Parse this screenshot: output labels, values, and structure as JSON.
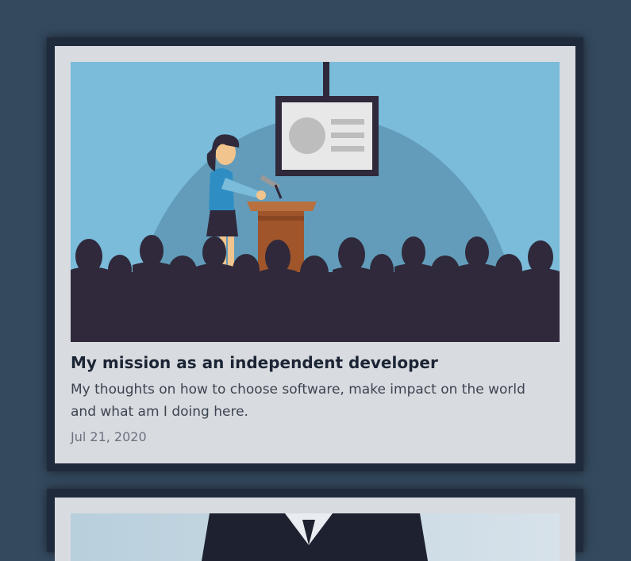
{
  "posts": [
    {
      "title": "My mission as an independent developer",
      "description": "My thoughts on how to choose software, make impact on the world and what am I doing here.",
      "date": "Jul 21, 2020",
      "image_icon": "presentation-illustration"
    },
    {
      "image_icon": "person-in-suit-photo"
    }
  ],
  "colors": {
    "page_background": "#34495e",
    "card_background": "#d8dbdf",
    "card_border": "#1f2b3c",
    "title_color": "#1c2535",
    "sky": "#7abcda",
    "audience": "#2f293b"
  }
}
